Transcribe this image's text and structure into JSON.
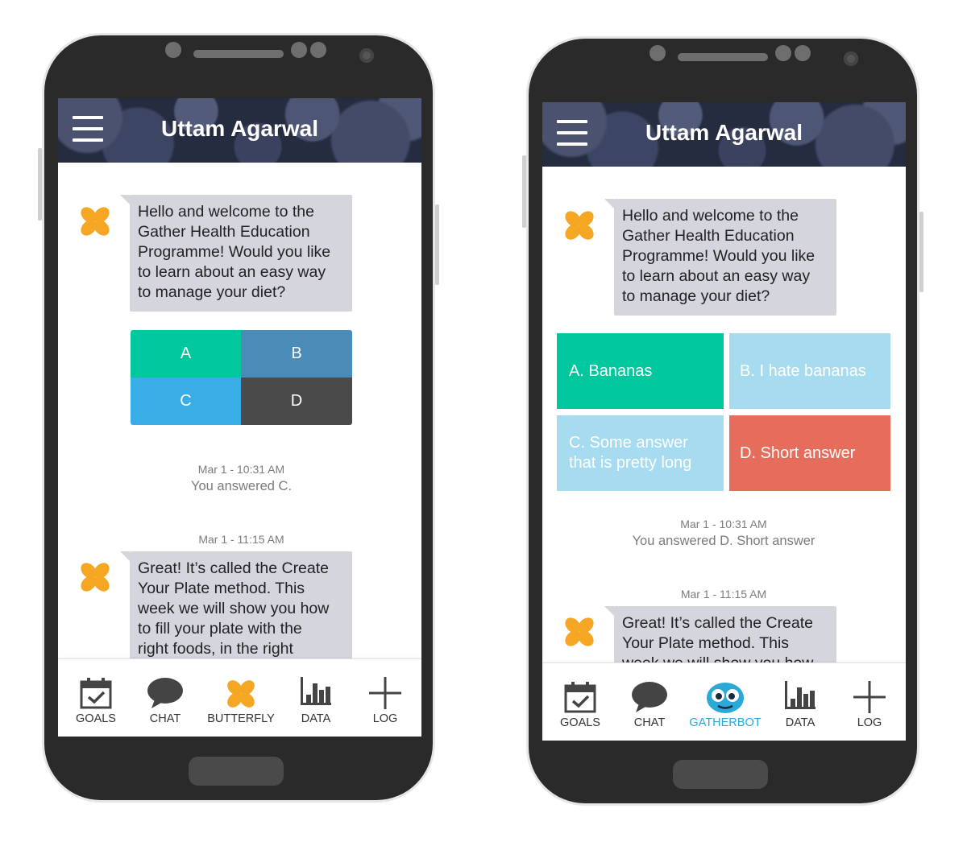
{
  "colors": {
    "bubble": "#d5d6dd",
    "opt_green": "#00c79d",
    "opt_blue": "#4a8bb7",
    "opt_lightblue": "#39aee6",
    "opt_dark": "#4a4a4a",
    "opt_paleblue": "#a6dbf0",
    "opt_coral": "#e66d5b",
    "gatherbot_active": "#2aa8d6"
  },
  "left": {
    "header_title": "Uttam Agarwal",
    "welcome_message": [
      "Hello and welcome to the",
      "Gather Health Education",
      "Programme! Would you like",
      "to learn about an easy way",
      "to manage your diet?"
    ],
    "options": [
      "A",
      "B",
      "C",
      "D"
    ],
    "answer_stamp": "Mar 1 - 10:31 AM",
    "answered_text": "You answered C.",
    "second_stamp": "Mar 1  - 11:15 AM",
    "second_message": [
      "Great! It’s called the Create",
      "Your Plate method. This",
      "week we will show you how",
      "to fill your plate with the",
      "right foods, in the right"
    ],
    "tabs": [
      {
        "icon": "calendar-check-icon",
        "label": "GOALS"
      },
      {
        "icon": "chat-bubble-icon",
        "label": "CHAT"
      },
      {
        "icon": "butterfly-icon",
        "label": "BUTTERFLY"
      },
      {
        "icon": "bar-chart-icon",
        "label": "DATA"
      },
      {
        "icon": "plus-icon",
        "label": "LOG"
      }
    ]
  },
  "right": {
    "header_title": "Uttam Agarwal",
    "welcome_message": [
      "Hello and welcome to the",
      "Gather Health Education",
      "Programme! Would you like",
      "to learn about an easy way",
      "to manage your diet?"
    ],
    "options": [
      "A. Bananas",
      "B. I hate bananas",
      "C. Some answer that is pretty long",
      "D. Short answer"
    ],
    "answer_stamp": "Mar 1 - 10:31 AM",
    "answered_text": "You answered D. Short answer",
    "second_stamp": "Mar 1  - 11:15 AM",
    "second_message": [
      "Great! It’s called the Create",
      "Your Plate method. This",
      "week we will show you how"
    ],
    "tabs": [
      {
        "icon": "calendar-check-icon",
        "label": "GOALS"
      },
      {
        "icon": "chat-bubble-icon",
        "label": "CHAT"
      },
      {
        "icon": "gatherbot-icon",
        "label": "GATHERBOT"
      },
      {
        "icon": "bar-chart-icon",
        "label": "DATA"
      },
      {
        "icon": "plus-icon",
        "label": "LOG"
      }
    ]
  }
}
